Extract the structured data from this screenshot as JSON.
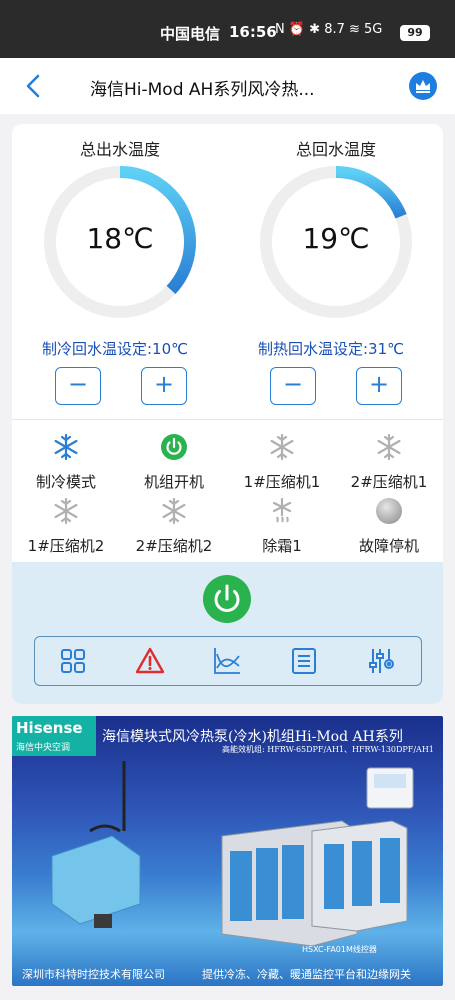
{
  "status_bar": {
    "carrier": "中国电信",
    "time": "16:56",
    "icons_text": "N ⏰ ✱ 8.7 ≋ 5G",
    "battery": "99"
  },
  "header": {
    "title": "海信Hi-Mod AH系列风冷热...",
    "back_icon": "chevron-left-icon",
    "action_icon": "crown-icon"
  },
  "gauges": [
    {
      "title": "总出水温度",
      "value": "18℃",
      "fill_fraction": 0.37
    },
    {
      "title": "总回水温度",
      "value": "19℃",
      "fill_fraction": 0.19
    }
  ],
  "setpoints": {
    "cooling": "制冷回水温设定:10℃",
    "heating": "制热回水温设定:31℃",
    "minus_label": "−",
    "plus_label": "+"
  },
  "status_items": [
    {
      "label": "制冷模式",
      "icon": "snowflake-icon",
      "color": "#2a7fd4"
    },
    {
      "label": "机组开机",
      "icon": "power-icon",
      "color": "#29b24e"
    },
    {
      "label": "1#压缩机1",
      "icon": "snowflake-icon",
      "color": "#b0b0b0"
    },
    {
      "label": "2#压缩机1",
      "icon": "snowflake-icon",
      "color": "#b0b0b0"
    },
    {
      "label": "1#压缩机2",
      "icon": "snowflake-icon",
      "color": "#b0b0b0"
    },
    {
      "label": "2#压缩机2",
      "icon": "snowflake-icon",
      "color": "#b0b0b0"
    },
    {
      "label": "除霜1",
      "icon": "defrost-icon",
      "color": "#b0b0b0"
    },
    {
      "label": "故障停机",
      "icon": "fault-indicator-icon",
      "color": "#b0b0b0"
    }
  ],
  "toolbar": [
    {
      "icon": "grid-icon"
    },
    {
      "icon": "alarm-warning-icon"
    },
    {
      "icon": "trend-chart-icon"
    },
    {
      "icon": "list-icon"
    },
    {
      "icon": "settings-sliders-icon"
    }
  ],
  "banner": {
    "brand": "Hisense",
    "brand_sub": "海信中央空调",
    "title": "海信模块式风冷热泵(冷水)机组Hi-Mod AH系列",
    "models": "高能效机组: HFRW-65DPF/AH1、HFRW-130DPF/AH1",
    "controller": "HSXC-FA01M线控器",
    "company": "深圳市科特时控技术有限公司",
    "slogan": "提供冷冻、冷藏、暖通监控平台和边缘网关"
  },
  "colors": {
    "accent": "#2a7fd4",
    "gauge_track": "#eeeeee",
    "power_green": "#29b24e",
    "alarm_red": "#e02d2d"
  }
}
